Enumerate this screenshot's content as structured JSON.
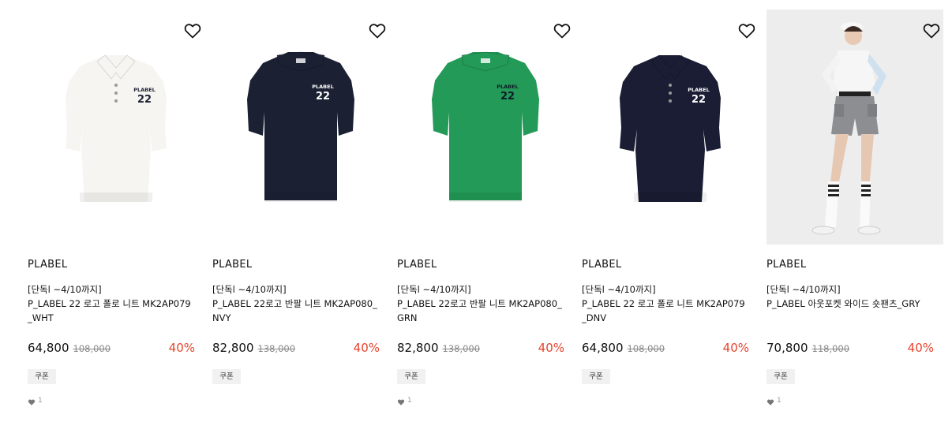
{
  "products": [
    {
      "brand": "PLABEL",
      "tag": "[단독l ~4/10까지]",
      "name": "P_LABEL 22 로고 폴로 니트 MK2AP079_WHT",
      "price": "64,800",
      "original_price": "108,000",
      "discount": "40%",
      "coupon_label": "쿠폰",
      "like_count": "1",
      "image": {
        "type": "polo",
        "color": "#f6f5f1",
        "logo_color": "#1b1f35",
        "logo_brand": "PLABEL",
        "logo_number": "22"
      }
    },
    {
      "brand": "PLABEL",
      "tag": "[단독l ~4/10까지]",
      "name": "P_LABEL 22로고 반팔 니트 MK2AP080_NVY",
      "price": "82,800",
      "original_price": "138,000",
      "discount": "40%",
      "coupon_label": "쿠폰",
      "like_count": "",
      "image": {
        "type": "knit",
        "color": "#1b2033",
        "logo_color": "#ffffff",
        "logo_brand": "PLABEL",
        "logo_number": "22"
      }
    },
    {
      "brand": "PLABEL",
      "tag": "[단독l ~4/10까지]",
      "name": "P_LABEL 22로고 반팔 니트 MK2AP080_GRN",
      "price": "82,800",
      "original_price": "138,000",
      "discount": "40%",
      "coupon_label": "쿠폰",
      "like_count": "1",
      "image": {
        "type": "knit",
        "color": "#239a57",
        "logo_color": "#0f1a2a",
        "logo_brand": "PLABEL",
        "logo_number": "22"
      }
    },
    {
      "brand": "PLABEL",
      "tag": "[단독l ~4/10까지]",
      "name": "P_LABEL 22 로고 폴로 니트 MK2AP079_DNV",
      "price": "64,800",
      "original_price": "108,000",
      "discount": "40%",
      "coupon_label": "쿠폰",
      "like_count": "",
      "image": {
        "type": "polo",
        "color": "#1a1d33",
        "logo_color": "#ffffff",
        "logo_brand": "PLABEL",
        "logo_number": "22"
      }
    },
    {
      "brand": "PLABEL",
      "tag": "[단독l ~4/10까지]",
      "name": "P_LABEL 아웃포켓 와이드 숏팬츠_GRY",
      "price": "70,800",
      "original_price": "118,000",
      "discount": "40%",
      "coupon_label": "쿠폰",
      "like_count": "1",
      "image": {
        "type": "model-photo",
        "color": "#8c8e91",
        "logo_color": "",
        "logo_brand": "",
        "logo_number": ""
      }
    }
  ],
  "colors": {
    "discount": "#e8432c",
    "strike": "#888888",
    "coupon_bg": "#f1f1f1",
    "like": "#999999"
  },
  "icons": {
    "wishlist": "heart-outline-icon",
    "like": "heart-filled-icon"
  }
}
